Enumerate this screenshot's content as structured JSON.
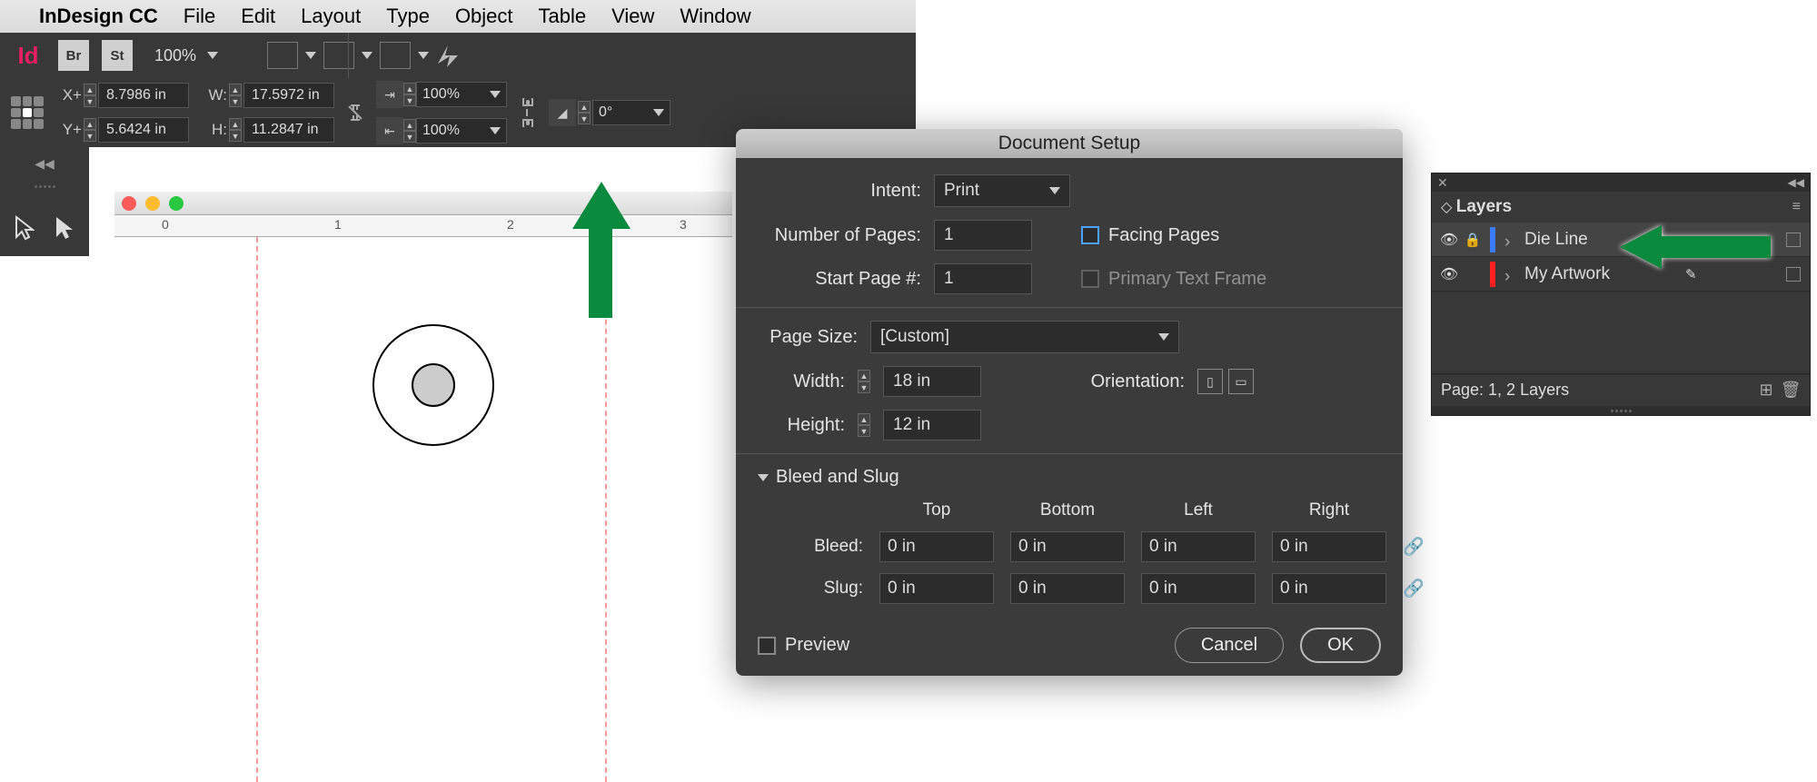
{
  "menubar": {
    "app": "InDesign CC",
    "items": [
      "File",
      "Edit",
      "Layout",
      "Type",
      "Object",
      "Table",
      "View",
      "Window"
    ]
  },
  "toolbar": {
    "br": "Br",
    "st": "St",
    "zoom": "100%"
  },
  "ctrl": {
    "xlab": "X+",
    "x": "8.7986 in",
    "ylab": "Y+",
    "y": "5.6424 in",
    "wlab": "W:",
    "w": "17.5972 in",
    "hlab": "H:",
    "h": "11.2847 in",
    "sx": "100%",
    "sy": "100%",
    "rot": "0°"
  },
  "ruler": {
    "t0": "0",
    "t1": "1",
    "t2": "2",
    "t3": "3"
  },
  "dialog": {
    "title": "Document Setup",
    "intent_lab": "Intent:",
    "intent": "Print",
    "npages_lab": "Number of Pages:",
    "npages": "1",
    "facing": "Facing Pages",
    "start_lab": "Start Page #:",
    "start": "1",
    "ptf": "Primary Text Frame",
    "psize_lab": "Page Size:",
    "psize": "[Custom]",
    "w_lab": "Width:",
    "w": "18 in",
    "h_lab": "Height:",
    "h": "12 in",
    "ori_lab": "Orientation:",
    "section": "Bleed and Slug",
    "top": "Top",
    "bottom": "Bottom",
    "left": "Left",
    "right": "Right",
    "bleed": "Bleed:",
    "slug": "Slug:",
    "bt": "0 in",
    "bb": "0 in",
    "bl": "0 in",
    "br": "0 in",
    "st": "0 in",
    "sb": "0 in",
    "sl": "0 in",
    "sr": "0 in",
    "preview": "Preview",
    "cancel": "Cancel",
    "ok": "OK"
  },
  "layers": {
    "title": "Layers",
    "l1": "Die Line",
    "c1": "#3b7cff",
    "l2": "My Artwork",
    "c2": "#ff2020",
    "footer": "Page: 1, 2 Layers"
  }
}
